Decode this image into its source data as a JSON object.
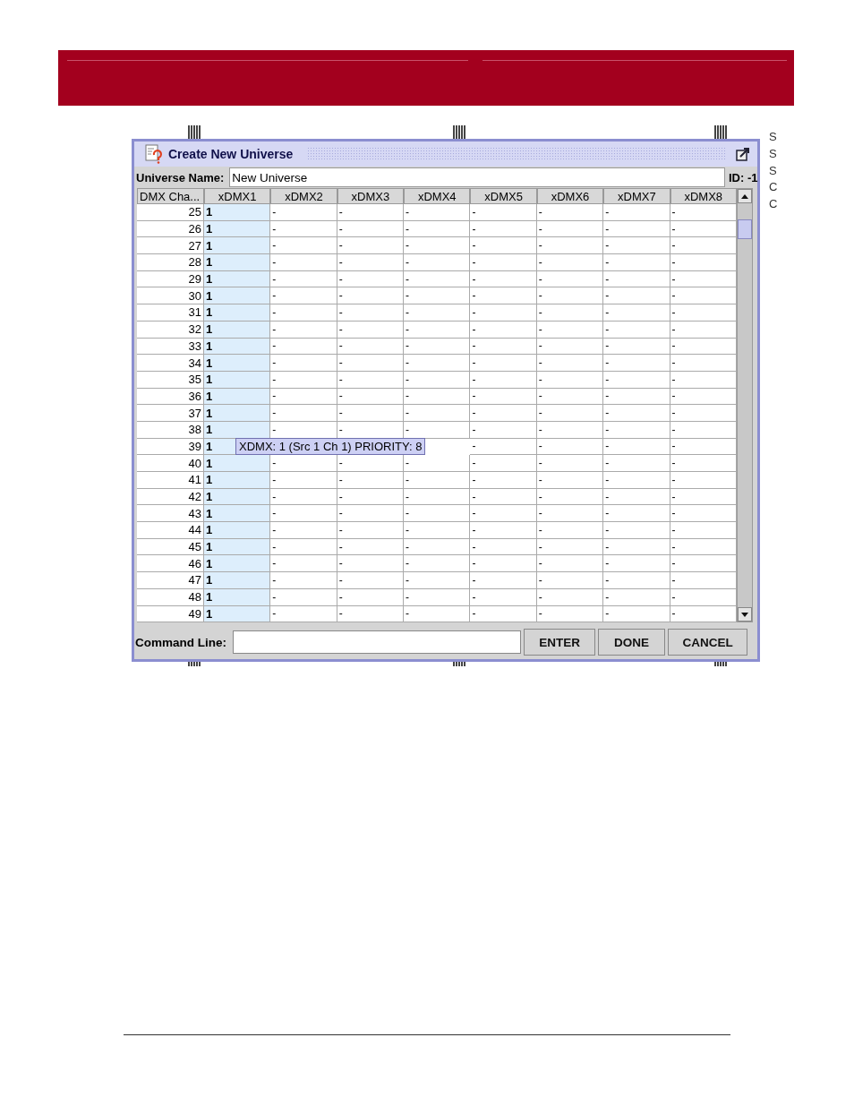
{
  "dialog": {
    "title": "Create New Universe",
    "name_label": "Universe Name:",
    "name_value": "New Universe",
    "id_label": "ID: -1"
  },
  "table": {
    "row_header": "DMX Cha...",
    "columns": [
      {
        "label": "xDMX1",
        "selected": true
      },
      {
        "label": "xDMX2",
        "selected": false
      },
      {
        "label": "xDMX3",
        "selected": false
      },
      {
        "label": "xDMX4",
        "selected": false
      },
      {
        "label": "xDMX5",
        "selected": false
      },
      {
        "label": "xDMX6",
        "selected": false
      },
      {
        "label": "xDMX7",
        "selected": false
      },
      {
        "label": "xDMX8",
        "selected": false
      }
    ],
    "rows": [
      {
        "channel": "25",
        "cells": [
          "1",
          "-",
          "-",
          "-",
          "-",
          "-",
          "-",
          "-"
        ]
      },
      {
        "channel": "26",
        "cells": [
          "1",
          "-",
          "-",
          "-",
          "-",
          "-",
          "-",
          "-"
        ]
      },
      {
        "channel": "27",
        "cells": [
          "1",
          "-",
          "-",
          "-",
          "-",
          "-",
          "-",
          "-"
        ]
      },
      {
        "channel": "28",
        "cells": [
          "1",
          "-",
          "-",
          "-",
          "-",
          "-",
          "-",
          "-"
        ]
      },
      {
        "channel": "29",
        "cells": [
          "1",
          "-",
          "-",
          "-",
          "-",
          "-",
          "-",
          "-"
        ]
      },
      {
        "channel": "30",
        "cells": [
          "1",
          "-",
          "-",
          "-",
          "-",
          "-",
          "-",
          "-"
        ]
      },
      {
        "channel": "31",
        "cells": [
          "1",
          "-",
          "-",
          "-",
          "-",
          "-",
          "-",
          "-"
        ]
      },
      {
        "channel": "32",
        "cells": [
          "1",
          "-",
          "-",
          "-",
          "-",
          "-",
          "-",
          "-"
        ]
      },
      {
        "channel": "33",
        "cells": [
          "1",
          "-",
          "-",
          "-",
          "-",
          "-",
          "-",
          "-"
        ]
      },
      {
        "channel": "34",
        "cells": [
          "1",
          "-",
          "-",
          "-",
          "-",
          "-",
          "-",
          "-"
        ]
      },
      {
        "channel": "35",
        "cells": [
          "1",
          "-",
          "-",
          "-",
          "-",
          "-",
          "-",
          "-"
        ]
      },
      {
        "channel": "36",
        "cells": [
          "1",
          "-",
          "-",
          "-",
          "-",
          "-",
          "-",
          "-"
        ]
      },
      {
        "channel": "37",
        "cells": [
          "1",
          "-",
          "-",
          "-",
          "-",
          "-",
          "-",
          "-"
        ]
      },
      {
        "channel": "38",
        "cells": [
          "1",
          "-",
          "-",
          "-",
          "-",
          "-",
          "-",
          "-"
        ]
      },
      {
        "channel": "39",
        "cells": [
          "1",
          null,
          null,
          null,
          "-",
          "-",
          "-",
          "-"
        ]
      },
      {
        "channel": "40",
        "cells": [
          "1",
          "-",
          "-",
          "-",
          "-",
          "-",
          "-",
          "-"
        ]
      },
      {
        "channel": "41",
        "cells": [
          "1",
          "-",
          "-",
          "-",
          "-",
          "-",
          "-",
          "-"
        ]
      },
      {
        "channel": "42",
        "cells": [
          "1",
          "-",
          "-",
          "-",
          "-",
          "-",
          "-",
          "-"
        ]
      },
      {
        "channel": "43",
        "cells": [
          "1",
          "-",
          "-",
          "-",
          "-",
          "-",
          "-",
          "-"
        ]
      },
      {
        "channel": "44",
        "cells": [
          "1",
          "-",
          "-",
          "-",
          "-",
          "-",
          "-",
          "-"
        ]
      },
      {
        "channel": "45",
        "cells": [
          "1",
          "-",
          "-",
          "-",
          "-",
          "-",
          "-",
          "-"
        ]
      },
      {
        "channel": "46",
        "cells": [
          "1",
          "-",
          "-",
          "-",
          "-",
          "-",
          "-",
          "-"
        ]
      },
      {
        "channel": "47",
        "cells": [
          "1",
          "-",
          "-",
          "-",
          "-",
          "-",
          "-",
          "-"
        ]
      },
      {
        "channel": "48",
        "cells": [
          "1",
          "-",
          "-",
          "-",
          "-",
          "-",
          "-",
          "-"
        ]
      },
      {
        "channel": "49",
        "cells": [
          "1",
          "-",
          "-",
          "-",
          "-",
          "-",
          "-",
          "-"
        ]
      }
    ],
    "tooltip": "XDMX: 1 (Src 1 Ch 1) PRIORITY: 8"
  },
  "command_bar": {
    "label": "Command Line:",
    "buttons": [
      "ENTER",
      "DONE",
      "CANCEL"
    ]
  },
  "side_letters": [
    "S",
    "S",
    "S",
    "C",
    "C"
  ]
}
